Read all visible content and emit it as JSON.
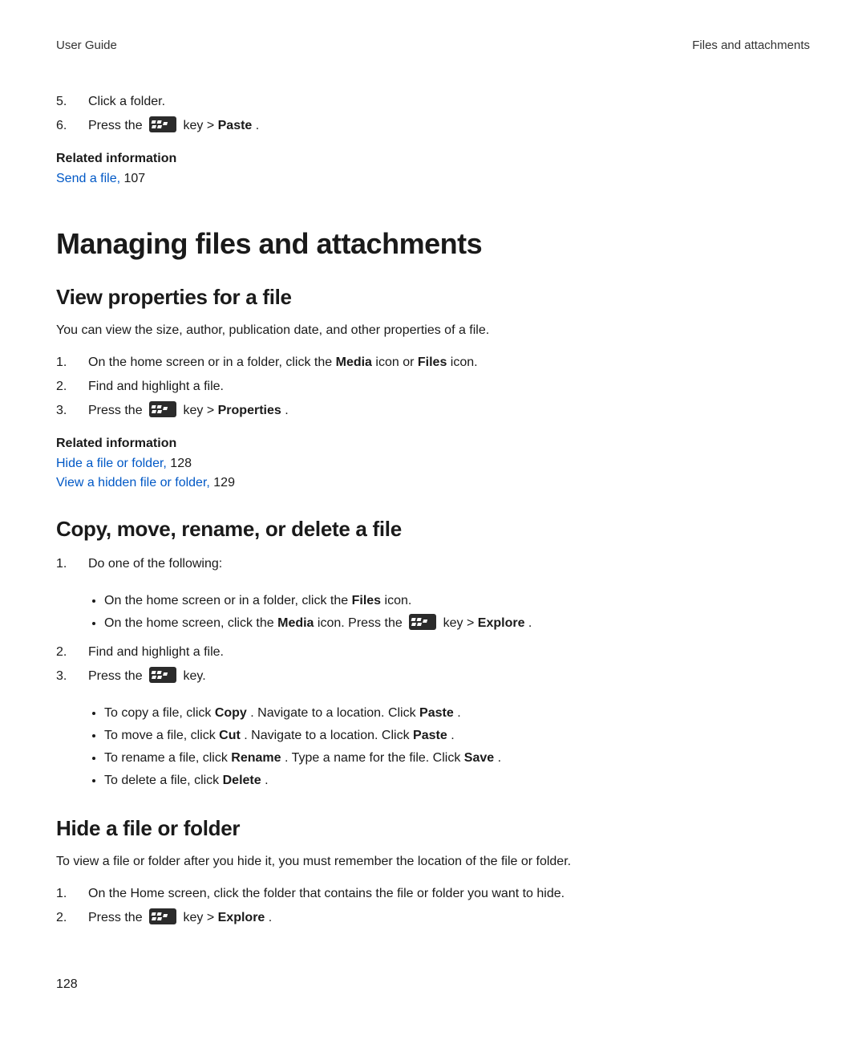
{
  "header": {
    "left": "User Guide",
    "right": "Files and attachments"
  },
  "top_steps": {
    "five": {
      "num": "5.",
      "text": "Click a folder."
    },
    "six": {
      "num": "6.",
      "pre": "Press the ",
      "mid": " key > ",
      "bold": "Paste",
      "post": "."
    }
  },
  "related_top": {
    "heading": "Related information",
    "link": "Send a file,",
    "page": " 107"
  },
  "h1": "Managing files and attachments",
  "section_view": {
    "heading": "View properties for a file",
    "intro": "You can view the size, author, publication date, and other properties of a file.",
    "steps": {
      "one": {
        "num": "1.",
        "p1": "On the home screen or in a folder, click the ",
        "b1": "Media",
        "p2": " icon or ",
        "b2": "Files",
        "p3": " icon."
      },
      "two": {
        "num": "2.",
        "text": "Find and highlight a file."
      },
      "three": {
        "num": "3.",
        "pre": "Press the ",
        "mid": " key > ",
        "bold": "Properties",
        "post": "."
      }
    },
    "related": {
      "heading": "Related information",
      "l1": {
        "link": "Hide a file or folder,",
        "page": " 128"
      },
      "l2": {
        "link": "View a hidden file or folder,",
        "page": " 129"
      }
    }
  },
  "section_copy": {
    "heading": "Copy, move, rename, or delete a file",
    "steps": {
      "one": {
        "num": "1.",
        "text": "Do one of the following:"
      },
      "two": {
        "num": "2.",
        "text": "Find and highlight a file."
      },
      "three": {
        "num": "3.",
        "pre": "Press the ",
        "post": " key."
      }
    },
    "bullets1": {
      "a": {
        "p1": "On the home screen or in a folder, click the ",
        "b1": "Files",
        "p2": " icon."
      },
      "b": {
        "p1": "On the home screen, click the ",
        "b1": "Media",
        "p2": " icon. Press the ",
        "mid": " key > ",
        "b2": "Explore",
        "p3": "."
      }
    },
    "bullets2": {
      "a": {
        "p1": "To copy a file, click ",
        "b1": "Copy",
        "p2": ". Navigate to a location. Click ",
        "b2": "Paste",
        "p3": "."
      },
      "b": {
        "p1": "To move a file, click ",
        "b1": "Cut",
        "p2": ". Navigate to a location. Click ",
        "b2": "Paste",
        "p3": "."
      },
      "c": {
        "p1": "To rename a file, click ",
        "b1": "Rename",
        "p2": ". Type a name for the file. Click ",
        "b2": "Save",
        "p3": "."
      },
      "d": {
        "p1": "To delete a file, click ",
        "b1": "Delete",
        "p2": "."
      }
    }
  },
  "section_hide": {
    "heading": "Hide a file or folder",
    "intro": "To view a file or folder after you hide it, you must remember the location of the file or folder.",
    "steps": {
      "one": {
        "num": "1.",
        "text": "On the Home screen, click the folder that contains the file or folder you want to hide."
      },
      "two": {
        "num": "2.",
        "pre": "Press the ",
        "mid": " key > ",
        "bold": "Explore",
        "post": "."
      }
    }
  },
  "page_number": "128"
}
